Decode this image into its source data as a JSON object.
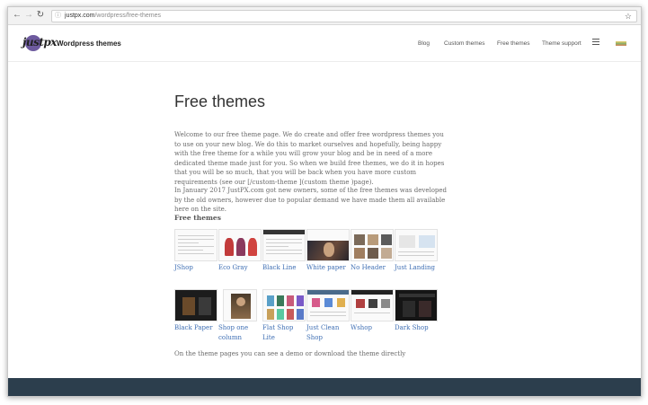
{
  "browser": {
    "url_host": "justpx.com",
    "url_path": "/wordpress/free-themes",
    "back_icon": "arrow-left",
    "forward_icon": "arrow-right",
    "reload_icon": "reload",
    "bookmark_icon": "star"
  },
  "header": {
    "logo_text": "justpx",
    "site_name": "Wordpress themes",
    "nav": [
      "Blog",
      "Custom themes",
      "Free themes",
      "Theme support"
    ]
  },
  "main": {
    "title": "Free themes",
    "paragraph1": "Welcome to our free theme page. We do create and offer free wordpress themes you to use on your new blog. We do this to market ourselves and hopefully, being happy with the free theme for a while you will grow your blog and be in need of a more dedicated theme made just for you. So when we build free themes, we do it in hopes that you will be so much, that you will be back when you have more custom requirements (see our [/custom-theme ](custom theme )page).",
    "paragraph2": "In January 2017 JustPX.com got new owners, some of the free themes was developed by the old owners, however due to popular demand we have made them all available here on the site.",
    "section_title": "Free themes",
    "themes": [
      {
        "name": "JShop"
      },
      {
        "name": "Eco Gray"
      },
      {
        "name": "Black Line"
      },
      {
        "name": "White paper"
      },
      {
        "name": "No Header"
      },
      {
        "name": "Just Landing"
      },
      {
        "name": "Black Paper"
      },
      {
        "name": "Shop one column"
      },
      {
        "name": "Flat Shop Lite"
      },
      {
        "name": "Just Clean Shop"
      },
      {
        "name": "Wshop"
      },
      {
        "name": "Dark Shop"
      }
    ],
    "footer_note": "On the theme pages you can see a demo or download the theme directly"
  },
  "colors": {
    "link": "#3f6fb4",
    "footer_bg": "#2c3e4d",
    "logo_accent": "#6d5a9e"
  }
}
